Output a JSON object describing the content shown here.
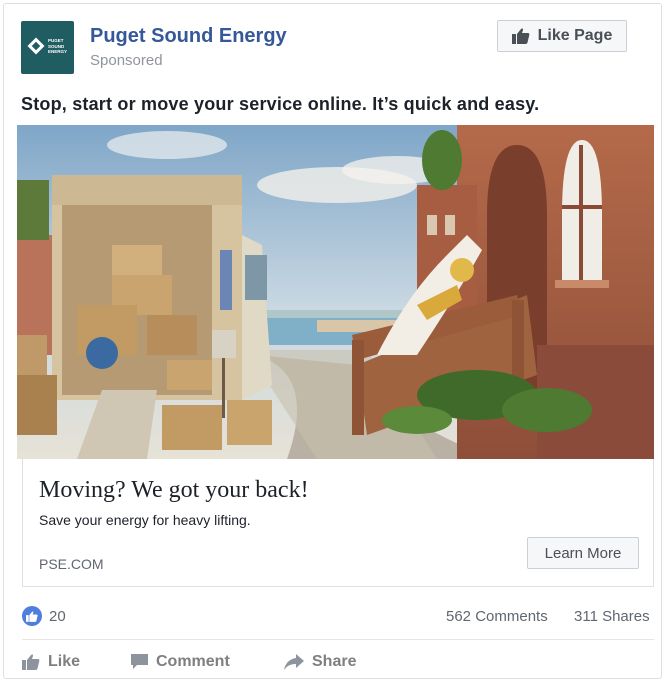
{
  "post": {
    "logo_text": "PUGET SOUND ENERGY",
    "page_name": "Puget Sound Energy",
    "sponsored": "Sponsored",
    "like_page_label": "Like Page",
    "headline": "Stop, start or move your service online. It’s quick and easy."
  },
  "link": {
    "title": "Moving? We got your back!",
    "description": "Save your energy for heavy lifting.",
    "domain": "PSE.COM",
    "cta_label": "Learn More"
  },
  "stats": {
    "reactions": "20",
    "comments": "562 Comments",
    "shares": "311 Shares"
  },
  "actions": {
    "like": "Like",
    "comment": "Comment",
    "share": "Share"
  },
  "colors": {
    "brand": "#1f5d62",
    "link_blue": "#365899",
    "reaction_blue": "#4f7fdc"
  }
}
